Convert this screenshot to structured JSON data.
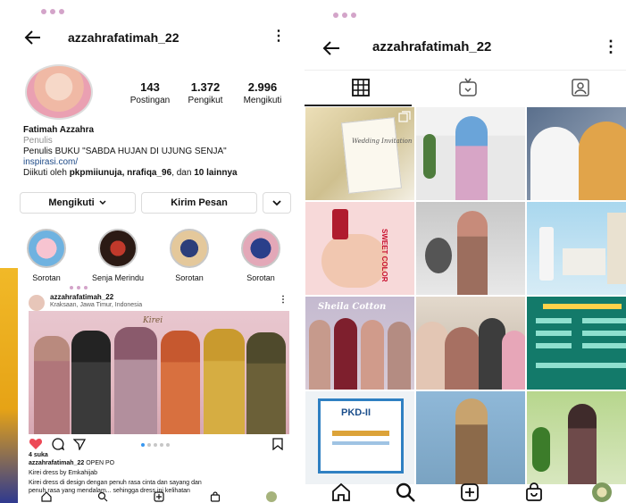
{
  "left": {
    "header": {
      "username": "azzahrafatimah_22"
    },
    "stats": [
      {
        "value": "143",
        "label": "Postingan"
      },
      {
        "value": "1.372",
        "label": "Pengikut"
      },
      {
        "value": "2.996",
        "label": "Mengikuti"
      }
    ],
    "bio": {
      "name": "Fatimah Azzahra",
      "category": "Penulis",
      "text": "Penulis BUKU \"SABDA HUJAN DI UJUNG SENJA\"",
      "link": "inspirasi.com/",
      "followed_prefix": "Diikuti oleh ",
      "followed_names": "pkpmiiunuja, nrafiqa_96",
      "followed_mid": ", dan ",
      "followed_more": "10 lainnya"
    },
    "buttons": {
      "following": "Mengikuti",
      "message": "Kirim Pesan"
    },
    "highlights": [
      {
        "label": "Sorotan"
      },
      {
        "label": "Senja Merindu"
      },
      {
        "label": "Sorotan"
      },
      {
        "label": "Sorotan"
      }
    ],
    "post": {
      "username": "azzahrafatimah_22",
      "location": "Kraksaan, Jawa Timur, Indonesia",
      "image_title": "Kirei",
      "likes": "4 suka",
      "caption_user": "azzahrafatimah_22",
      "caption_tail": " OPEN PO",
      "caption_line2": "Kirei dress by Emkahijab",
      "caption_line3": "Kirei dress di design dengan penuh rasa cinta dan sayang dan",
      "caption_line4": "penuh rasa yang mendalam... sehingga dress ini kelihatan"
    }
  },
  "right": {
    "header": {
      "username": "azzahrafatimah_22"
    },
    "tiles": [
      {
        "text": "Wedding Invitation"
      },
      {
        "text": ""
      },
      {
        "text": ""
      },
      {
        "text": ""
      },
      {
        "text": ""
      },
      {
        "text": "SWEET COLOR"
      },
      {
        "text": "Sheila Cotton"
      },
      {
        "text": ""
      },
      {
        "text": ""
      },
      {
        "text": "PKD-II"
      },
      {
        "text": ""
      },
      {
        "text": ""
      }
    ]
  },
  "icons": {
    "back": "arrow-left-icon",
    "menu": "kebab-menu-icon",
    "grid": "grid-icon",
    "igtv": "igtv-icon",
    "tagged": "tagged-icon",
    "home": "home-icon",
    "search": "search-icon",
    "add": "add-post-icon",
    "shop": "shop-bag-icon"
  },
  "colors": {
    "accent_heart": "#ed4956",
    "link": "#1e4a87",
    "dots": "#d3a4c9"
  }
}
